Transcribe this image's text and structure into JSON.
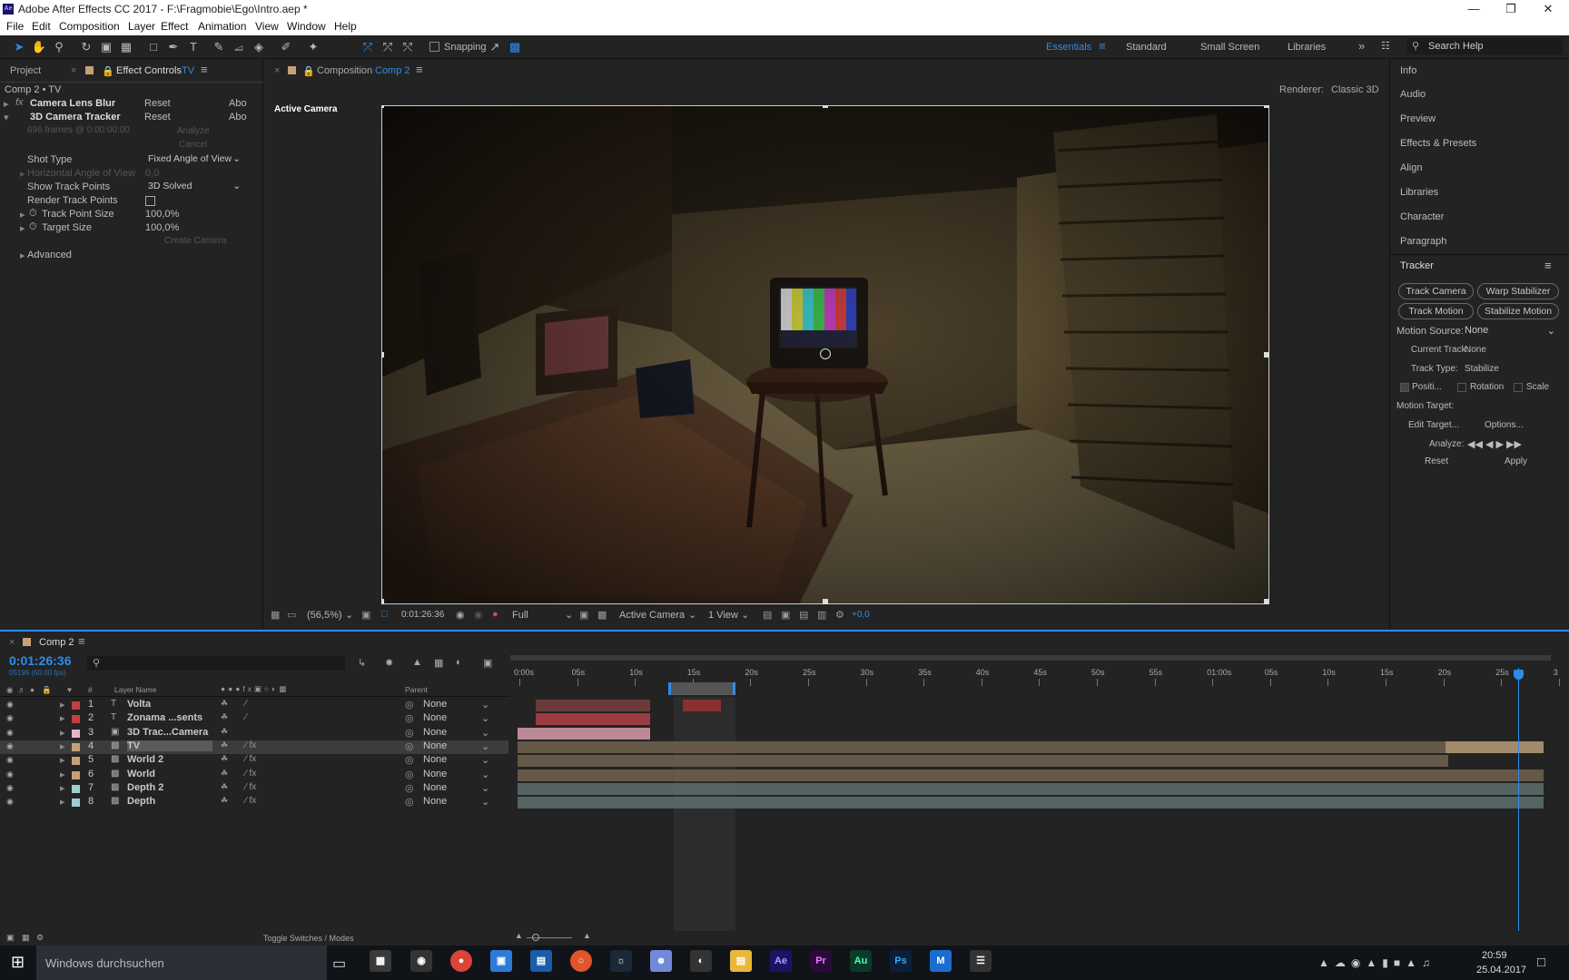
{
  "window": {
    "title": "Adobe After Effects CC 2017 - F:\\Fragmobie\\Ego\\Intro.aep *"
  },
  "menu": [
    "File",
    "Edit",
    "Composition",
    "Layer",
    "Effect",
    "Animation",
    "View",
    "Window",
    "Help"
  ],
  "toolbar": {
    "snapping": "Snapping",
    "workspaces": [
      "Essentials",
      "Standard",
      "Small Screen",
      "Libraries"
    ],
    "search_placeholder": "Search Help"
  },
  "left_panel": {
    "tab_project": "Project",
    "tab_effect_controls": "Effect Controls",
    "tab_target": "TV",
    "breadcrumb": "Comp 2 • TV",
    "effects": [
      {
        "name": "Camera Lens Blur",
        "reset": "Reset",
        "about": "Abo"
      },
      {
        "name": "3D Camera Tracker",
        "reset": "Reset",
        "about": "Abo"
      }
    ],
    "frames_info": "696 frames @ 0:00:00:00",
    "analyze": "Analyze",
    "cancel": "Cancel",
    "shot_type_label": "Shot Type",
    "shot_type_value": "Fixed Angle of View",
    "hfov_label": "Horizontal Angle of View",
    "hfov_value": "0,0",
    "show_track_label": "Show Track Points",
    "show_track_value": "3D Solved",
    "render_track_label": "Render Track Points",
    "track_size_label": "Track Point Size",
    "track_size_value": "100,0%",
    "target_size_label": "Target Size",
    "target_size_value": "100,0%",
    "create_camera": "Create Camera",
    "advanced": "Advanced"
  },
  "composition": {
    "tab_label": "Composition",
    "comp_name": "Comp 2",
    "renderer_label": "Renderer:",
    "renderer_value": "Classic 3D",
    "view_label": "Active Camera",
    "footer": {
      "zoom": "(56,5%)",
      "timecode": "0:01:26:36",
      "resolution": "Full",
      "camera": "Active Camera",
      "views": "1 View",
      "exposure": "+0,0"
    }
  },
  "right_panel": {
    "items": [
      "Info",
      "Audio",
      "Preview",
      "Effects & Presets",
      "Align",
      "Libraries",
      "Character",
      "Paragraph"
    ],
    "tracker_title": "Tracker",
    "buttons": [
      "Track Camera",
      "Warp Stabilizer",
      "Track Motion",
      "Stabilize Motion"
    ],
    "motion_source_label": "Motion Source:",
    "motion_source_value": "None",
    "current_track_label": "Current Track:",
    "current_track_value": "None",
    "track_type_label": "Track Type:",
    "track_type_value": "Stabilize",
    "checks": [
      "Positi...",
      "Rotation",
      "Scale"
    ],
    "motion_target_label": "Motion Target:",
    "edit_target": "Edit Target...",
    "options": "Options...",
    "analyze_label": "Analyze:",
    "reset": "Reset",
    "apply": "Apply"
  },
  "timeline": {
    "tab": "Comp 2",
    "timecode": "0:01:26:36",
    "fps": "05196 (60.00 fps)",
    "col_num": "#",
    "col_layer": "Layer Name",
    "col_parent": "Parent",
    "ruler": [
      "0:00s",
      "05s",
      "10s",
      "15s",
      "20s",
      "25s",
      "30s",
      "35s",
      "40s",
      "45s",
      "50s",
      "55s",
      "01:00s",
      "05s",
      "10s",
      "15s",
      "20s",
      "25s",
      "3"
    ],
    "layers": [
      {
        "num": "1",
        "name": "Volta",
        "type": "T",
        "color": "#c24040",
        "parent": "None"
      },
      {
        "num": "2",
        "name": "Zonama ...sents",
        "type": "T",
        "color": "#c24040",
        "parent": "None"
      },
      {
        "num": "3",
        "name": "3D Trac...Camera",
        "type": "cam",
        "color": "#e7b5c8",
        "parent": "None"
      },
      {
        "num": "4",
        "name": "TV",
        "type": "comp",
        "color": "#c8a078",
        "parent": "None"
      },
      {
        "num": "5",
        "name": "World 2",
        "type": "comp",
        "color": "#c8a078",
        "parent": "None"
      },
      {
        "num": "6",
        "name": "World",
        "type": "comp",
        "color": "#c8a078",
        "parent": "None"
      },
      {
        "num": "7",
        "name": "Depth 2",
        "type": "comp",
        "color": "#9fcfcf",
        "parent": "None"
      },
      {
        "num": "8",
        "name": "Depth",
        "type": "comp",
        "color": "#9fcfcf",
        "parent": "None"
      }
    ],
    "toggle": "Toggle Switches / Modes"
  },
  "taskbar": {
    "search": "Windows durchsuchen",
    "time": "20:59",
    "date": "25.04.2017",
    "apps": [
      "Ae",
      "Pr",
      "Au",
      "Ps"
    ]
  }
}
